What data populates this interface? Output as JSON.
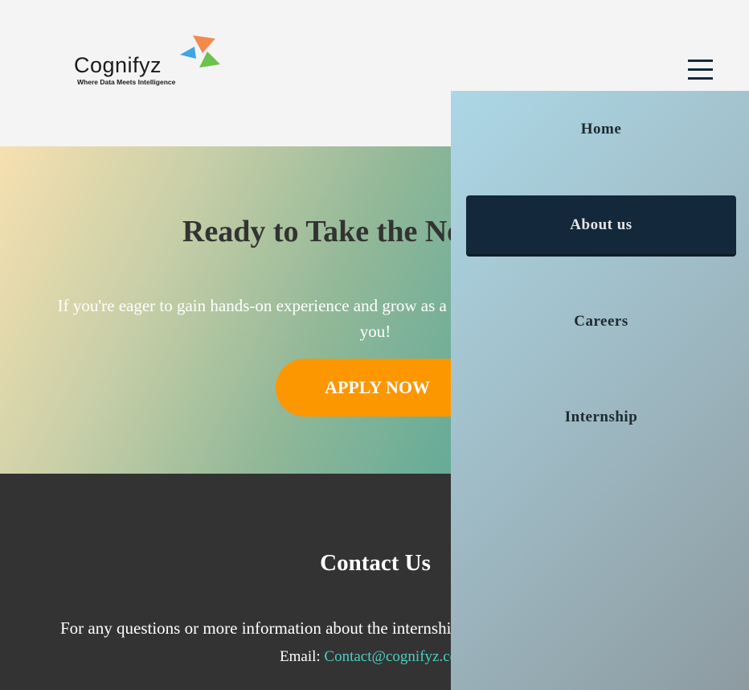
{
  "header": {
    "logo_text": "Cognifyz",
    "logo_tagline": "Where Data Meets Intelligence",
    "menu_icon": "hamburger-menu-icon"
  },
  "hero": {
    "heading": "Ready to Take the Next Step?",
    "text": "If you're eager to gain hands-on experience and grow as a web developer, this internship is for you!",
    "apply_label": "APPLY NOW"
  },
  "contact": {
    "heading": "Contact Us",
    "text": "For any questions or more information about the internship, reach out to us:",
    "email_label": "Email:",
    "email": "Contact@cognifyz.com"
  },
  "menu": {
    "items": [
      {
        "label": "Home",
        "active": false
      },
      {
        "label": "About us",
        "active": true
      },
      {
        "label": "Careers",
        "active": false
      },
      {
        "label": "Internship",
        "active": false
      }
    ]
  },
  "colors": {
    "accent": "#fd9700",
    "nav_dark": "#13283a",
    "footer_bg": "#333333",
    "link": "#4ecdc4"
  }
}
